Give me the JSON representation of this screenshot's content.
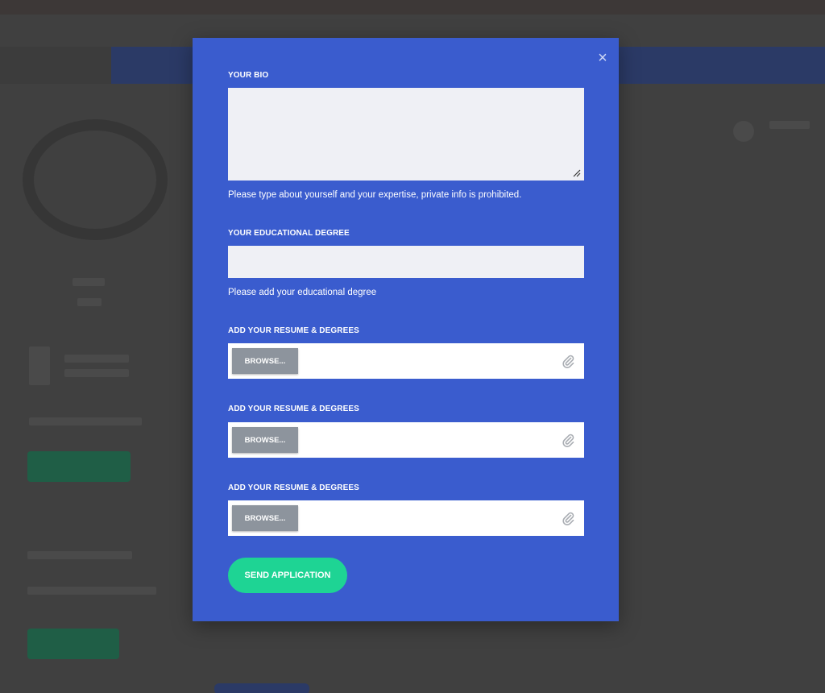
{
  "modal": {
    "close_glyph": "×",
    "bio": {
      "label": "YOUR BIO",
      "value": "",
      "helper": "Please type about yourself and your expertise, private info is prohibited."
    },
    "degree": {
      "label": "YOUR EDUCATIONAL DEGREE",
      "value": "",
      "helper": "Please add your educational degree"
    },
    "uploads": [
      {
        "label": "ADD YOUR RESUME & DEGREES",
        "button": "BROWSE..."
      },
      {
        "label": "ADD YOUR RESUME & DEGREES",
        "button": "BROWSE..."
      },
      {
        "label": "ADD YOUR RESUME & DEGREES",
        "button": "BROWSE..."
      }
    ],
    "submit_label": "SEND APPLICATION"
  },
  "icons": {
    "close": "close-icon",
    "attachment": "paperclip-icon",
    "resize": "resize-grip-icon"
  },
  "colors": {
    "modal_bg": "#3a5cce",
    "input_bg": "#eff0f5",
    "browse_bg": "#8d949d",
    "submit_bg": "#1ed494",
    "overlay": "#404040"
  }
}
